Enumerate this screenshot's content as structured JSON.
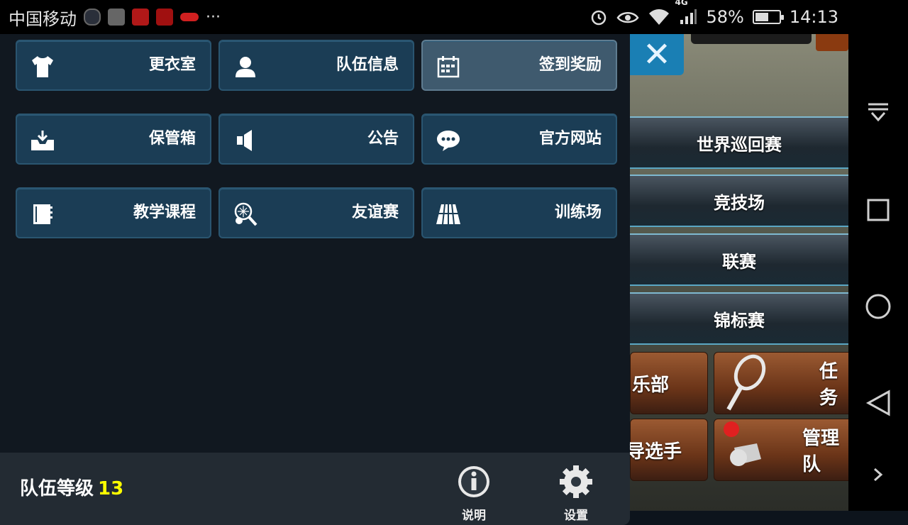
{
  "status_bar": {
    "carrier": "中国移动",
    "network": "4G",
    "battery": "58%",
    "battery_level": 0.58,
    "time": "14:13",
    "more": "···"
  },
  "menu": {
    "rows": [
      [
        {
          "label": "更衣室",
          "icon": "shirt-icon"
        },
        {
          "label": "队伍信息",
          "icon": "person-icon"
        },
        {
          "label": "签到奖励",
          "icon": "calendar-icon",
          "active": true
        }
      ],
      [
        {
          "label": "保管箱",
          "icon": "inbox-icon"
        },
        {
          "label": "公告",
          "icon": "speaker-icon"
        },
        {
          "label": "官方网站",
          "icon": "chat-icon"
        }
      ],
      [
        {
          "label": "教学课程",
          "icon": "notebook-icon"
        },
        {
          "label": "友谊赛",
          "icon": "racket-icon"
        },
        {
          "label": "训练场",
          "icon": "court-icon"
        }
      ]
    ]
  },
  "footer": {
    "team_level_label": "队伍等级",
    "team_level": "13",
    "help_label": "说明",
    "settings_label": "设置"
  },
  "game_menu": {
    "items": [
      "世界巡回赛",
      "竞技场",
      "联赛",
      "锦标赛"
    ],
    "tiles": [
      "乐部",
      "任务",
      "导选手",
      "管理队"
    ]
  },
  "colors": {
    "panel_bg": "#111820",
    "button_bg": "#1b3d55",
    "button_active_bg": "#3f5a6e",
    "level_number": "#ffff00",
    "close_button": "#1a7fb4"
  }
}
